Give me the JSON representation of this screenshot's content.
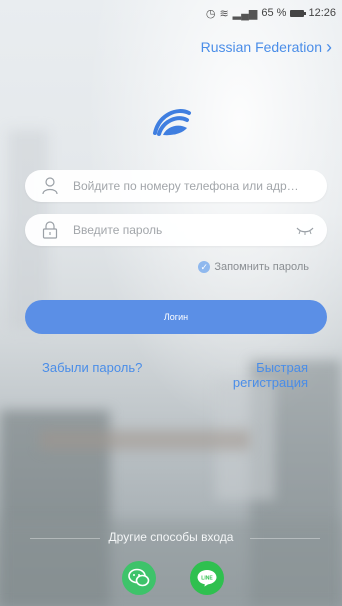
{
  "status_bar": {
    "battery_percent": "65 %",
    "time": "12:26"
  },
  "region": {
    "label": "Russian Federation"
  },
  "account_field": {
    "placeholder": "Войдите по номеру телефона или адрес..."
  },
  "password_field": {
    "placeholder": "Введите пароль"
  },
  "remember": {
    "label": "Запомнить пароль",
    "checked": true
  },
  "login_button": {
    "label": "Логин"
  },
  "links": {
    "forgot_password": "Забыли пароль?",
    "quick_register": "Быстрая регистрация"
  },
  "other_login": {
    "title": "Другие способы входа",
    "methods": [
      "wechat-icon",
      "line-icon"
    ]
  },
  "colors": {
    "accent": "#4a8de8",
    "button": "#5b8fe6",
    "wechat": "#3ec36a",
    "line": "#2fc04f"
  }
}
